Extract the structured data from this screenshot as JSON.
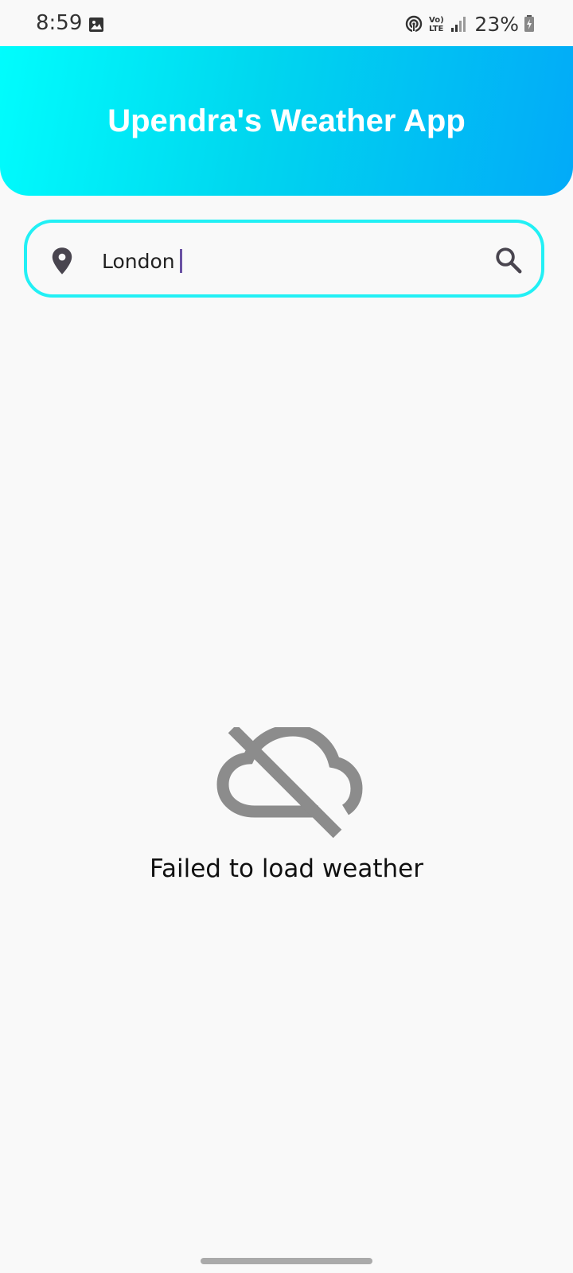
{
  "status_bar": {
    "time": "8:59",
    "battery": "23%",
    "icons": [
      "gallery-icon",
      "hotspot-icon",
      "volte-icon",
      "signal-icon",
      "battery-icon"
    ]
  },
  "header": {
    "title": "Upendra's Weather App",
    "gradient_start": "#00fdfd",
    "gradient_end": "#02aaf8"
  },
  "search": {
    "value": "London",
    "border_color": "#22f0f5",
    "leading_icon": "location-pin-icon",
    "trailing_icon": "search-icon"
  },
  "error": {
    "icon": "cloud-off-icon",
    "message": "Failed to load weather"
  }
}
